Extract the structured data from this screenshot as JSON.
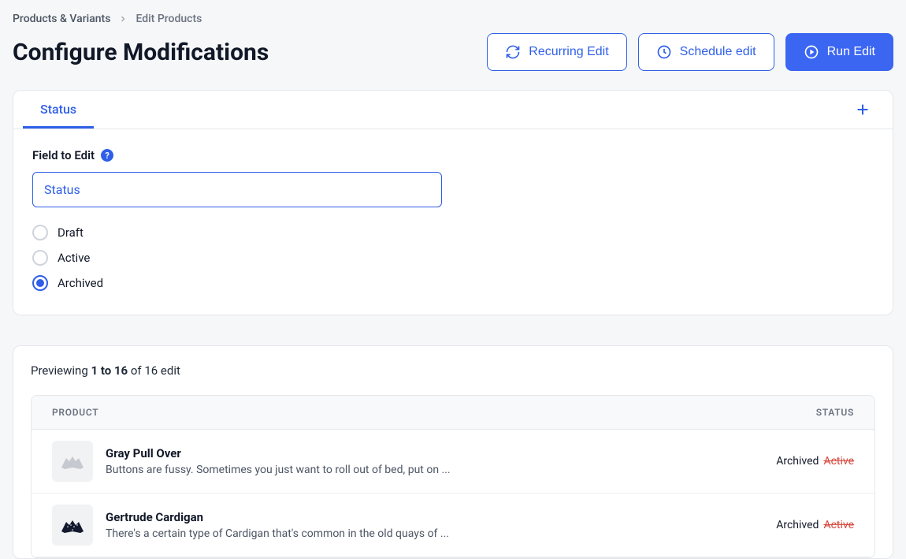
{
  "breadcrumb": {
    "root": "Products & Variants",
    "current": "Edit Products"
  },
  "header": {
    "title": "Configure Modifications",
    "recurring_label": "Recurring Edit",
    "schedule_label": "Schedule edit",
    "run_label": "Run Edit"
  },
  "tabs": {
    "active": "Status"
  },
  "field": {
    "label": "Field to Edit",
    "selected": "Status",
    "options": [
      {
        "label": "Draft",
        "checked": false
      },
      {
        "label": "Active",
        "checked": false
      },
      {
        "label": "Archived",
        "checked": true
      }
    ]
  },
  "preview": {
    "heading_prefix": "Previewing ",
    "heading_bold": "1 to 16",
    "heading_suffix": " of 16 edit",
    "cols": {
      "product": "PRODUCT",
      "status": "STATUS"
    },
    "rows": [
      {
        "name": "Gray Pull Over",
        "desc": "Buttons are fussy. Sometimes you just want to roll out of bed, put on ...",
        "new_status": "Archived",
        "old_status": "Active",
        "thumb": "gray"
      },
      {
        "name": "Gertrude Cardigan",
        "desc": "There's a certain type of Cardigan that's common in the old quays of ...",
        "new_status": "Archived",
        "old_status": "Active",
        "thumb": "navy"
      }
    ]
  }
}
